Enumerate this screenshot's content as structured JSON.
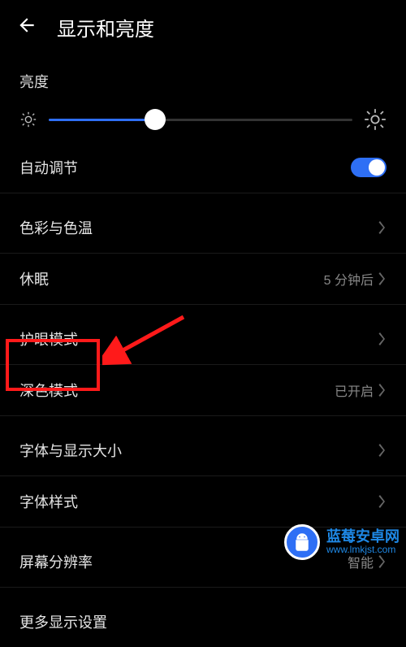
{
  "header": {
    "title": "显示和亮度"
  },
  "brightness": {
    "label": "亮度",
    "value_percent": 35,
    "auto_label": "自动调节",
    "auto_enabled": true
  },
  "group1": [
    {
      "label": "色彩与色温",
      "value": ""
    },
    {
      "label": "休眠",
      "value": "5 分钟后"
    }
  ],
  "group2": [
    {
      "label": "护眼模式",
      "value": ""
    },
    {
      "label": "深色模式",
      "value": "已开启"
    }
  ],
  "group3": [
    {
      "label": "字体与显示大小",
      "value": ""
    },
    {
      "label": "字体样式",
      "value": ""
    }
  ],
  "group4": [
    {
      "label": "屏幕分辨率",
      "value": "智能"
    }
  ],
  "group5": [
    {
      "label": "更多显示设置",
      "value": ""
    }
  ],
  "watermark": {
    "title": "蓝莓安卓网",
    "url": "www.lmkjst.com"
  }
}
